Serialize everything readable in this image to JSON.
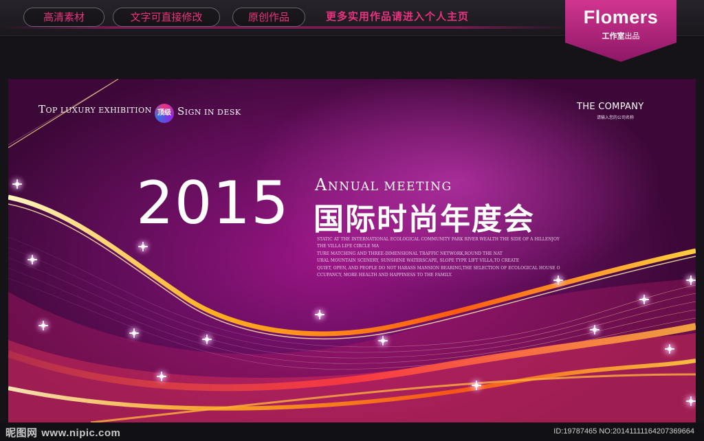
{
  "topbar": {
    "pill1": "高清素材",
    "pill2": "文字可直接修改",
    "pill3": "原创作品",
    "promo": "更多实用作品请进入个人主页"
  },
  "brand": {
    "name": "Flomers",
    "sub_bold": "工作室",
    "sub_rest": "出品"
  },
  "banner": {
    "top_left_cap": "T",
    "top_left_rest": "OP LUXURY EXHIBITION",
    "badge": "顶级",
    "top_right_cap": "S",
    "top_right_rest": "IGN IN DESK",
    "company": "THE COMPANY",
    "company_sub": "请输入您的公司名称",
    "year": "2015",
    "annual_cap": "A",
    "annual_rest": "NNUAL MEETING",
    "title_cn": "国际时尚年度会",
    "paragraph": [
      "STATIC AT THE INTERNATIONAL ECOLOGICAL COMMUNITY PARK RIVER WEALTH THE SIDE OF A HILLENJOY",
      "THE VILLA LIFE CIRCLE MA",
      "TURE MATCHING AND THREE-DIMENSIONAL TRAFFIC NETWORK,ROUND THE NAT",
      "URAL MOUNTAIN SCENERY, SUNSHINE WATERSCAPE, SLOPE TYPE LIFT VILLA,TO CREATE",
      "QUIET, OPEN, AND PEOPLE DO NOT HARASS MANSION BEARING,THE SELECTION OF ECOLOGICAL HOUSE O",
      "CCUPANCY, MORE HEALTH AND HAPPINESS TO THE FAMILY."
    ]
  },
  "footer": {
    "site_cn": "昵图网",
    "site_url": "www.nipic.com",
    "id_line": "ID:19787465 NO:20141111164207369664"
  },
  "colors": {
    "accent": "#e8337f",
    "banner_purple": "#7a1070",
    "wave_gold": "#ffb020"
  }
}
